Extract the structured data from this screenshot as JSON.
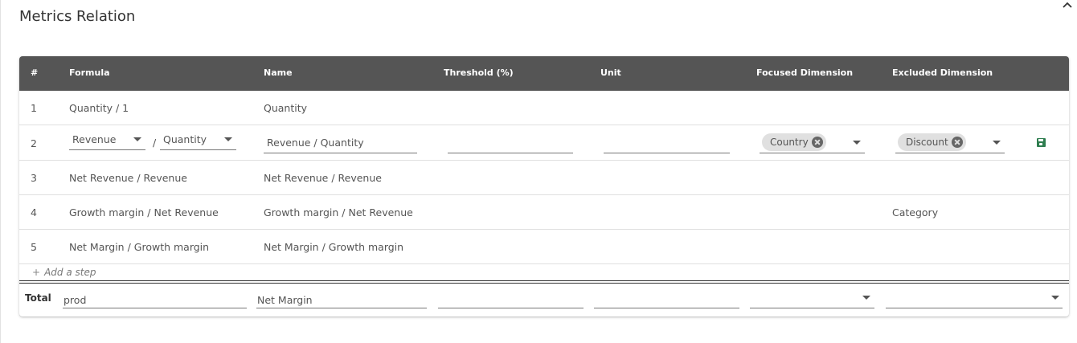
{
  "section": {
    "title": "Metrics Relation"
  },
  "table": {
    "columns": [
      "#",
      "Formula",
      "Name",
      "Threshold (%)",
      "Unit",
      "Focused Dimension",
      "Excluded Dimension"
    ],
    "rows": [
      {
        "num": "1",
        "formula": "Quantity / 1",
        "name": "Quantity",
        "threshold": "",
        "unit": "",
        "focused": "",
        "excluded": ""
      },
      {
        "num": "2",
        "editing": true,
        "formula_left": "Revenue",
        "formula_sep": "/",
        "formula_right": "Quantity",
        "name": "Revenue / Quantity",
        "threshold": "",
        "unit": "",
        "focused_chips": [
          "Country"
        ],
        "excluded_chips": [
          "Discount"
        ]
      },
      {
        "num": "3",
        "formula": "Net Revenue / Revenue",
        "name": "Net Revenue / Revenue",
        "threshold": "",
        "unit": "",
        "focused": "",
        "excluded": ""
      },
      {
        "num": "4",
        "formula": "Growth margin / Net Revenue",
        "name": "Growth margin / Net Revenue",
        "threshold": "",
        "unit": "",
        "focused": "",
        "excluded": "Category"
      },
      {
        "num": "5",
        "formula": "Net Margin / Growth margin",
        "name": "Net Margin / Growth margin",
        "threshold": "",
        "unit": "",
        "focused": "",
        "excluded": ""
      }
    ],
    "add_step_label": "Add a step"
  },
  "total": {
    "label": "Total",
    "formula_value": "prod",
    "name_value": "Net Margin",
    "threshold_value": "",
    "unit_value": "",
    "focused_value": "",
    "excluded_value": ""
  },
  "icons": {
    "collapse": "chevron-up-icon",
    "save": "save-icon",
    "chip_remove": "close-circle-icon",
    "add": "plus-icon",
    "dropdown": "caret-down-icon"
  },
  "colors": {
    "header_bg": "#555555",
    "save_icon": "#2e7d4f",
    "chip_bg": "#e0e0e0"
  }
}
